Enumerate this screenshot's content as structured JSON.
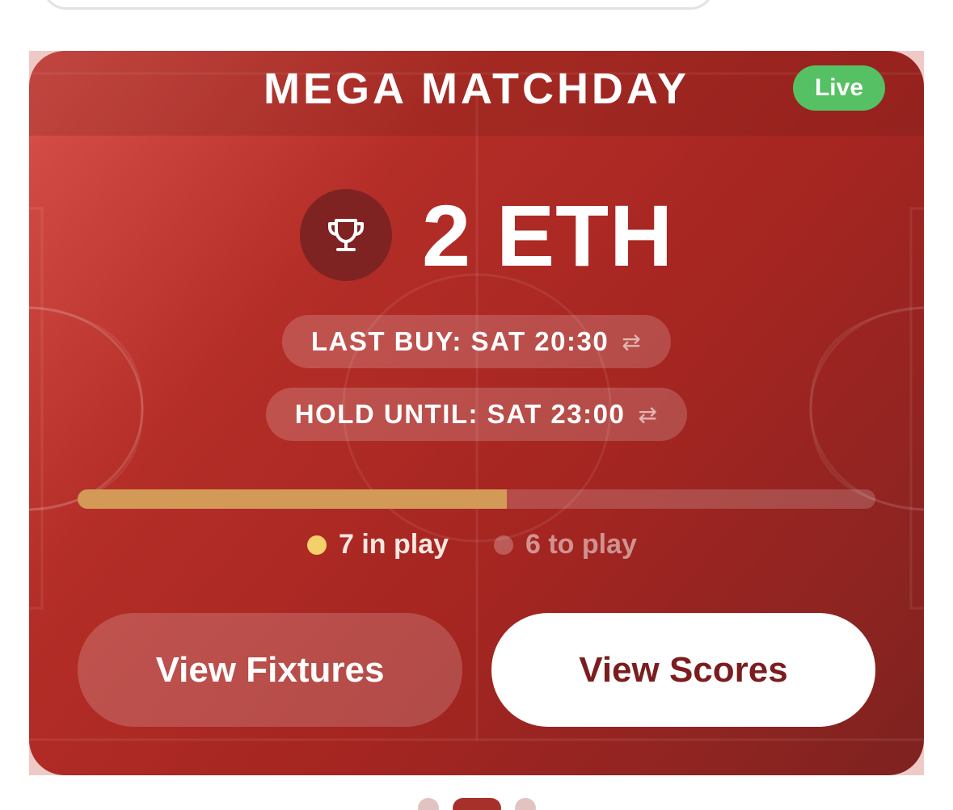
{
  "card": {
    "title": "MEGA MATCHDAY",
    "status_badge": "Live",
    "prize": "2 ETH",
    "trophy_icon": "trophy-icon",
    "last_buy": "LAST BUY: SAT 20:30",
    "hold_until": "HOLD UNTIL: SAT 23:00",
    "swap_icon": "⇄",
    "progress_fraction": 0.538,
    "legend": {
      "in_play": "7 in play",
      "to_play": "6 to play"
    },
    "buttons": {
      "view_fixtures": "View Fixtures",
      "view_scores": "View Scores"
    }
  },
  "colors": {
    "card_accent": "#a52521",
    "live": "#55c164",
    "progress": "#d39a57",
    "in_play_dot": "#f5d06a",
    "scores_text": "#7b1d1f"
  },
  "pager": {
    "count": 3,
    "active_index": 1
  }
}
